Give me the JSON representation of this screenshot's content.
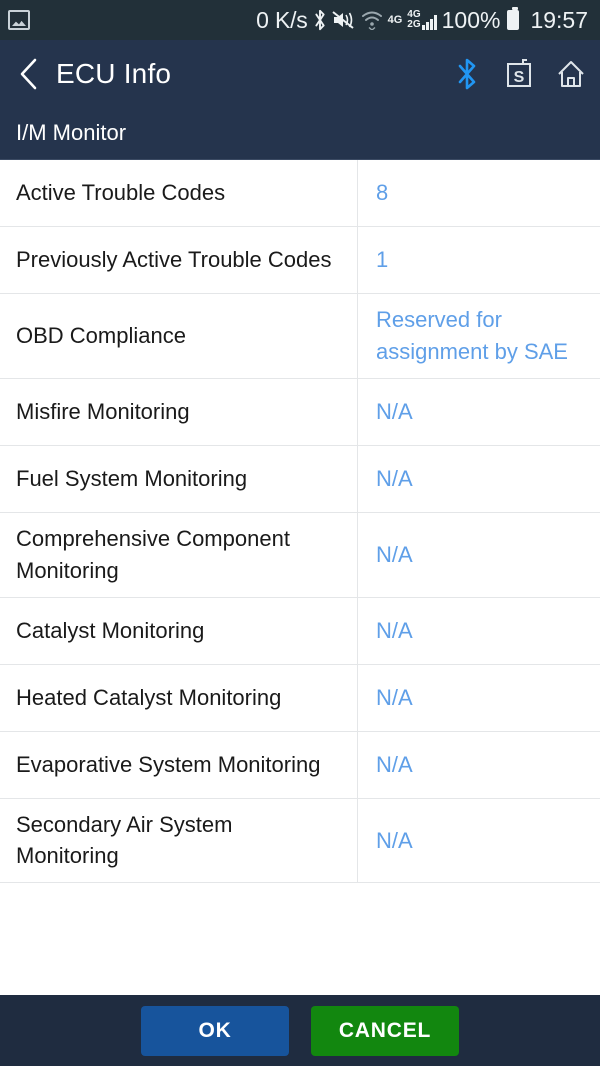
{
  "status_bar": {
    "gallery_icon": "image-icon",
    "network_speed": "0 K/s",
    "bluetooth_icon": "bluetooth-icon",
    "mute_icon": "volume-mute-vibrate-icon",
    "wifi_icon": "wifi-icon",
    "net_label_1": "4G",
    "net_label_2a": "4G",
    "net_label_2b": "2G",
    "battery_percent": "100%",
    "battery_icon": "battery-full-icon",
    "time": "19:57"
  },
  "app_bar": {
    "back_icon": "back-chevron-icon",
    "title": "ECU Info",
    "actions": [
      {
        "name": "bluetooth-icon",
        "label": "Bluetooth"
      },
      {
        "name": "s-box-icon",
        "label": "S"
      },
      {
        "name": "home-icon",
        "label": "Home"
      }
    ]
  },
  "sub_bar": {
    "title": "I/M Monitor"
  },
  "table": {
    "rows": [
      {
        "label": "Active Trouble Codes",
        "value": "8"
      },
      {
        "label": "Previously Active Trouble Codes",
        "value": "1"
      },
      {
        "label": "OBD Compliance",
        "value": "Reserved for assignment by SAE"
      },
      {
        "label": "Misfire Monitoring",
        "value": "N/A"
      },
      {
        "label": "Fuel System Monitoring",
        "value": "N/A"
      },
      {
        "label": "Comprehensive Component Monitoring",
        "value": "N/A"
      },
      {
        "label": "Catalyst Monitoring",
        "value": "N/A"
      },
      {
        "label": "Heated Catalyst Monitoring",
        "value": "N/A"
      },
      {
        "label": "Evaporative System Monitoring",
        "value": "N/A"
      },
      {
        "label": "Secondary Air System Monitoring",
        "value": "N/A"
      }
    ]
  },
  "bottom_bar": {
    "ok_label": "OK",
    "cancel_label": "CANCEL"
  },
  "colors": {
    "status_bar_bg": "#223039",
    "app_bar_bg": "#25344d",
    "bottom_bar_bg": "#1f2c40",
    "value_blue": "#5f9fe8",
    "ok_blue": "#17549c",
    "cancel_green": "#12870f",
    "bluetooth_blue": "#2196f3"
  }
}
